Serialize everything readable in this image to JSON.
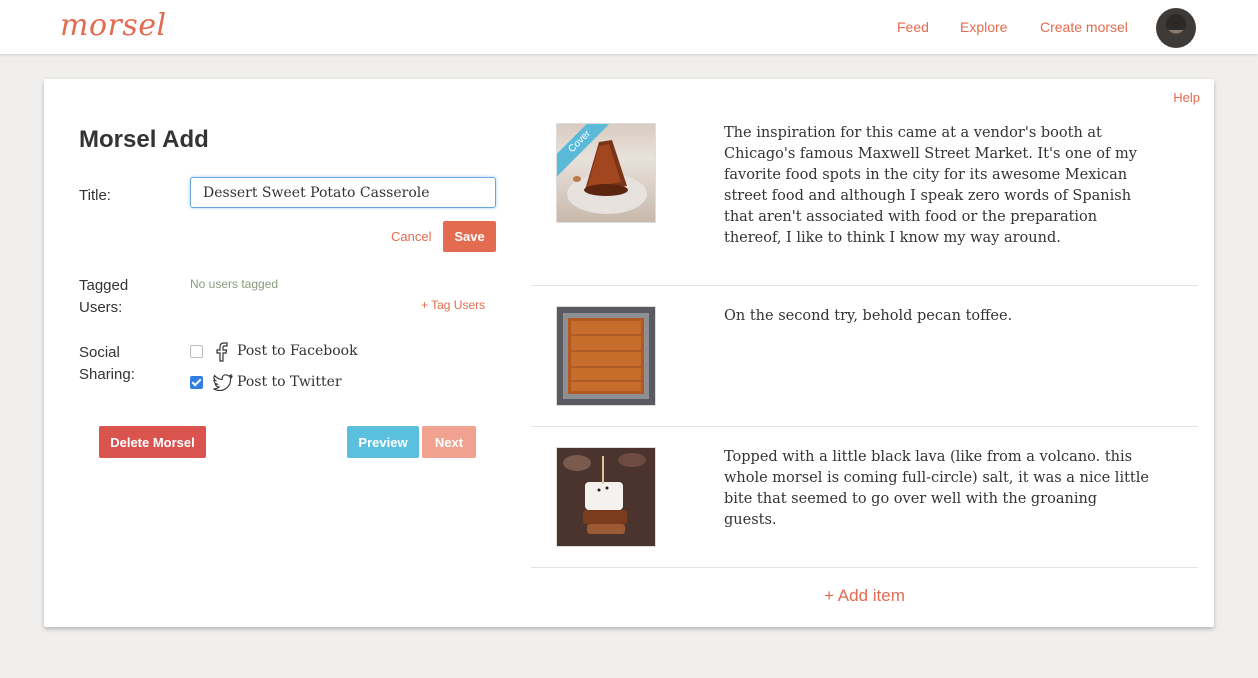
{
  "header": {
    "logo": "morsel",
    "nav": [
      "Feed",
      "Explore",
      "Create morsel"
    ]
  },
  "card": {
    "help": "Help",
    "title": "Morsel Add",
    "title_label": "Title:",
    "title_value": "Dessert Sweet Potato Casserole",
    "cancel": "Cancel",
    "save": "Save",
    "tagged_label_1": "Tagged",
    "tagged_label_2": "Users:",
    "no_users": "No users tagged",
    "tag_users": "+ Tag Users",
    "social_label_1": "Social",
    "social_label_2": "Sharing:",
    "facebook": "Post to Facebook",
    "twitter": "Post to Twitter",
    "facebook_checked": false,
    "twitter_checked": true,
    "delete": "Delete Morsel",
    "preview": "Preview",
    "next": "Next"
  },
  "items": [
    {
      "cover_badge": "Cover",
      "text": "The inspiration for this came at a vendor's booth at Chicago's famous Maxwell Street Market. It's one of my favorite food spots in the city for its awesome Mexican street food and although I speak zero words of Spanish that aren't associated with food or the preparation thereof, I like to think I know my way around."
    },
    {
      "text": "On the second try, behold pecan toffee."
    },
    {
      "text": "Topped with a little black lava (like from a volcano. this whole morsel is coming full-circle) salt, it was a nice little bite that seemed to go over well with the groaning guests."
    }
  ],
  "add_item": "+ Add item",
  "colors": {
    "accent": "#e36b4f",
    "danger": "#d9534f",
    "info": "#5bc0de",
    "next_disabled": "#f0a18f"
  }
}
